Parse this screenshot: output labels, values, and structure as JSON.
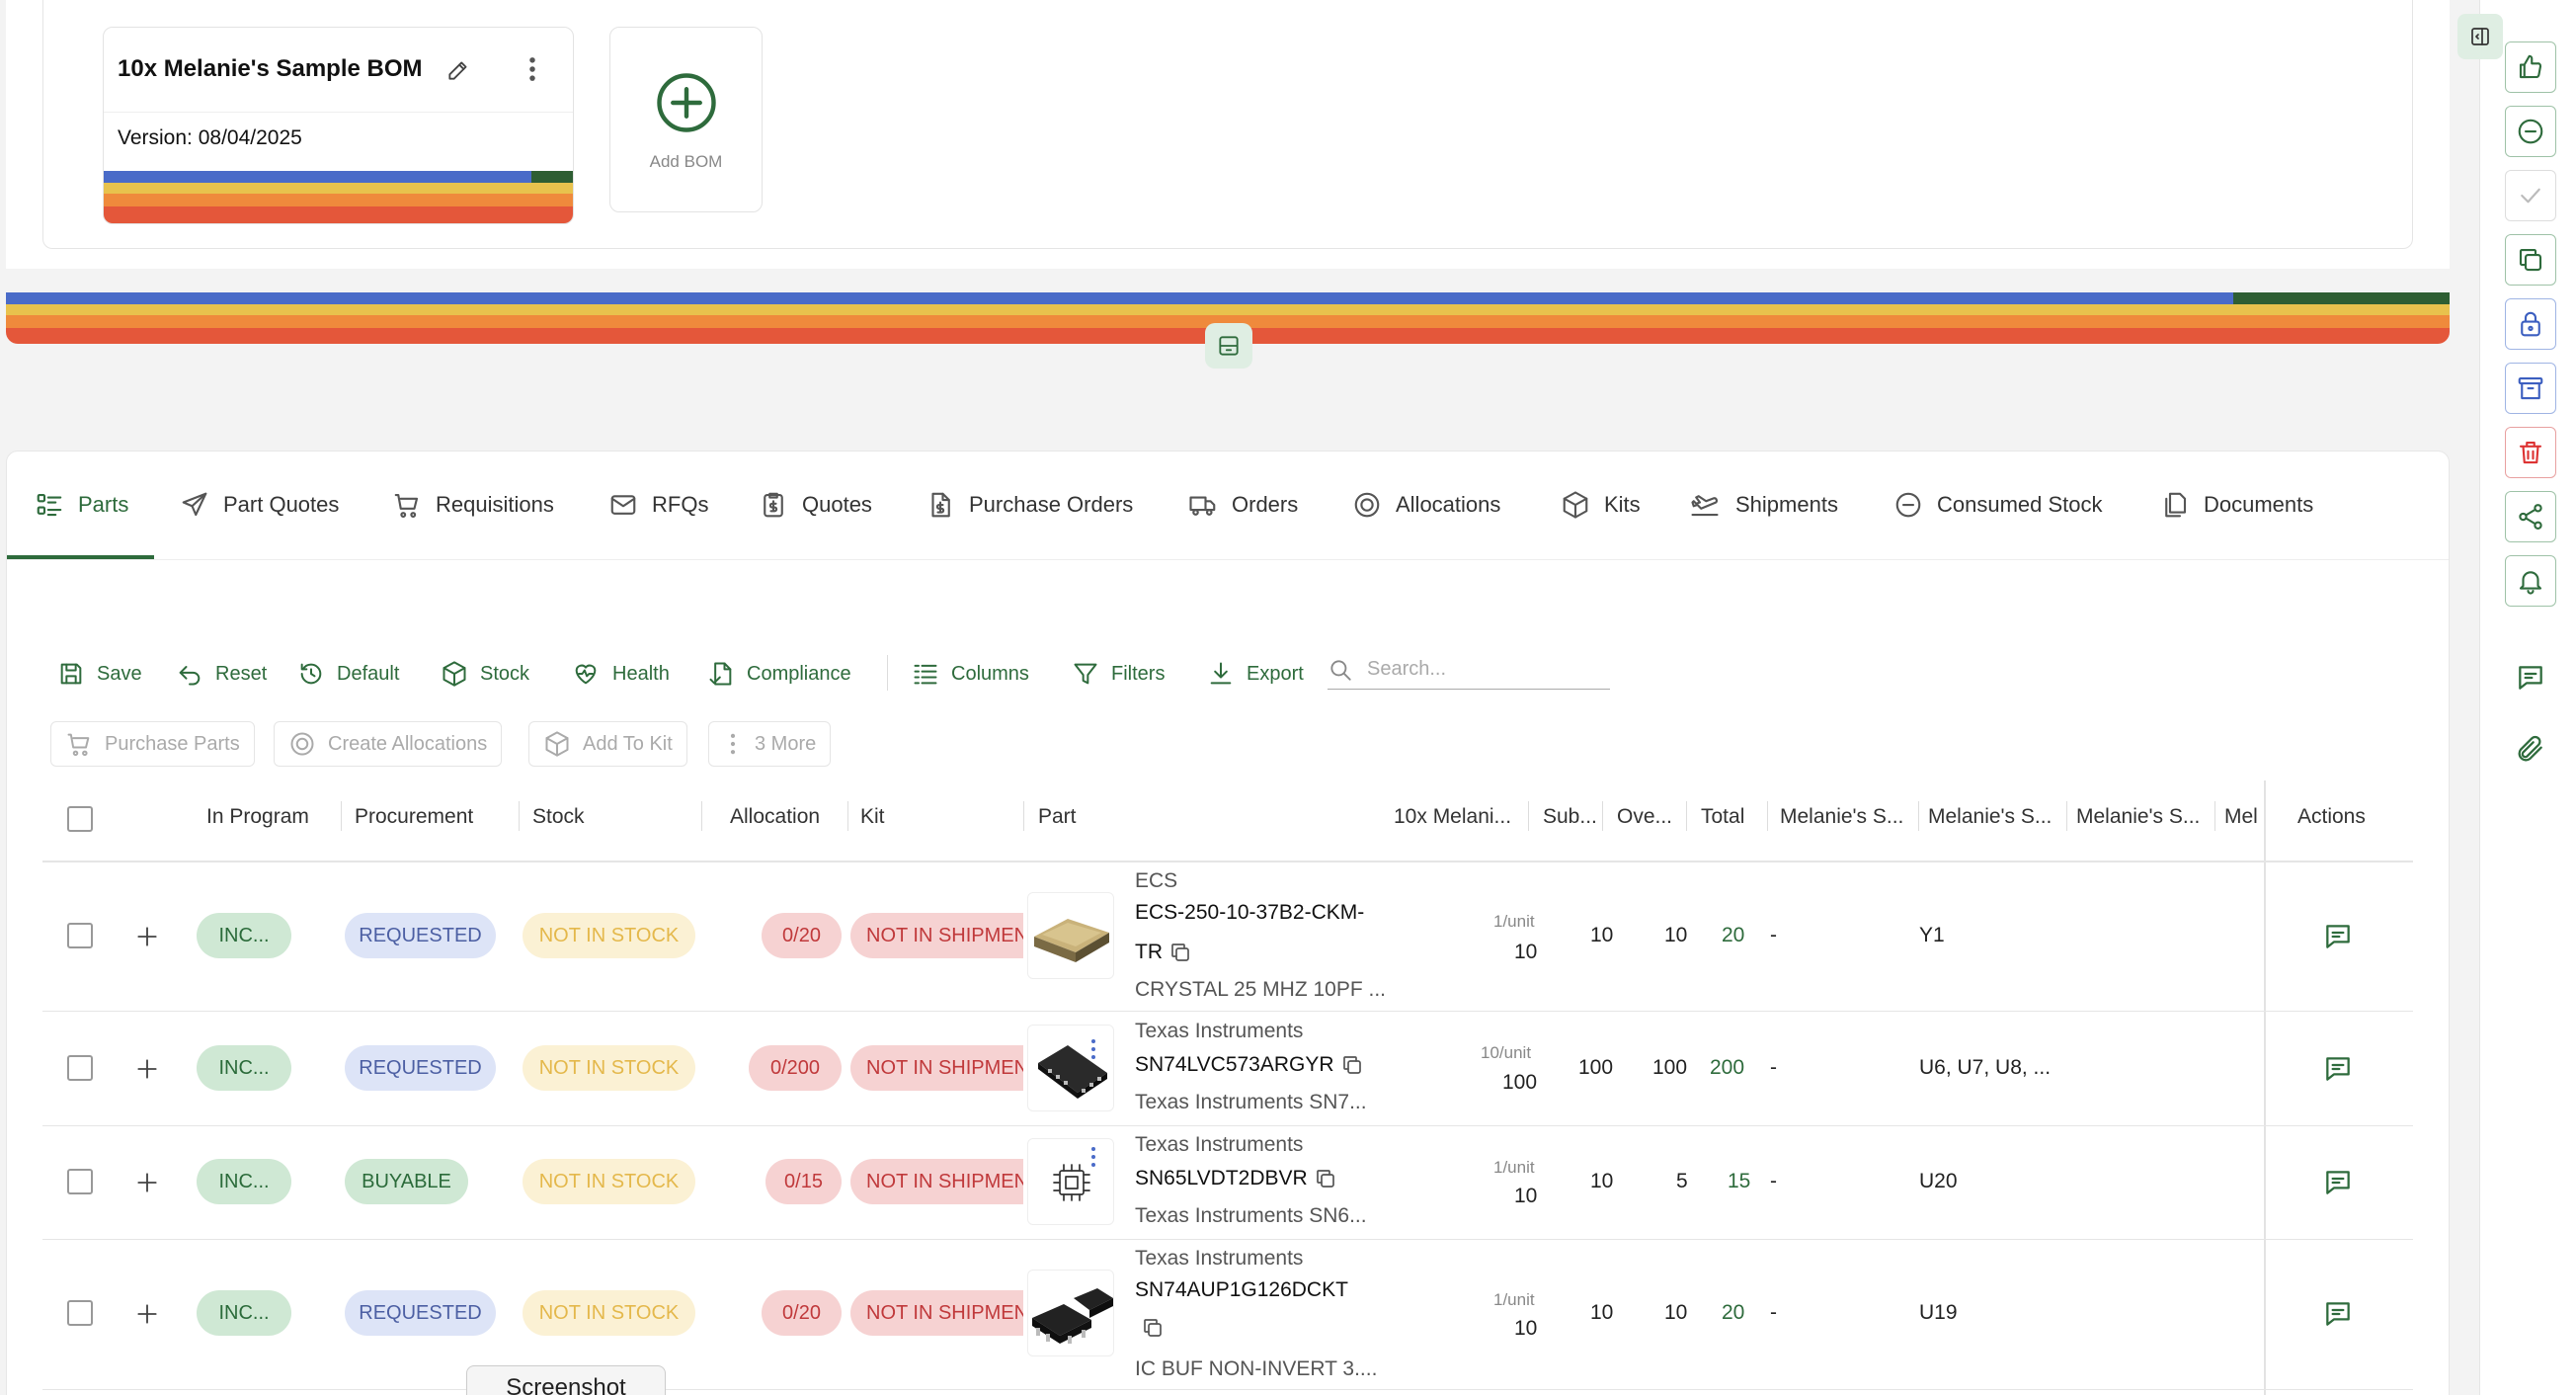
{
  "bom": {
    "title": "10x Melanie's Sample BOM",
    "version": "Version: 08/04/2025",
    "add_label": "Add BOM"
  },
  "status_colors": {
    "blue": "#4a6bc8",
    "yellow": "#e8c24d",
    "orange": "#ef8a3c",
    "red": "#e4573a",
    "green": "#2e6b3c"
  },
  "tabs": [
    {
      "label": "Parts",
      "icon": "list-icon",
      "active": true
    },
    {
      "label": "Part Quotes",
      "icon": "send-icon"
    },
    {
      "label": "Requisitions",
      "icon": "cart-icon"
    },
    {
      "label": "RFQs",
      "icon": "mail-icon"
    },
    {
      "label": "Quotes",
      "icon": "dollar-clipboard-icon"
    },
    {
      "label": "Purchase Orders",
      "icon": "dollar-file-icon"
    },
    {
      "label": "Orders",
      "icon": "truck-icon"
    },
    {
      "label": "Allocations",
      "icon": "target-icon"
    },
    {
      "label": "Kits",
      "icon": "box-icon"
    },
    {
      "label": "Shipments",
      "icon": "plane-icon"
    },
    {
      "label": "Consumed Stock",
      "icon": "minus-circle-icon"
    },
    {
      "label": "Documents",
      "icon": "documents-icon"
    }
  ],
  "toolbar": {
    "save": "Save",
    "reset": "Reset",
    "default": "Default",
    "stock": "Stock",
    "health": "Health",
    "compliance": "Compliance",
    "columns": "Columns",
    "filters": "Filters",
    "export": "Export",
    "search_placeholder": "Search...",
    "purchase_parts": "Purchase Parts",
    "create_allocations": "Create Allocations",
    "add_to_kit": "Add To Kit",
    "more": "3 More"
  },
  "columns": {
    "in_program": "In Program",
    "procurement": "Procurement",
    "stock": "Stock",
    "allocation": "Allocation",
    "kit": "Kit",
    "part": "Part",
    "bom_qty": "10x Melani...",
    "sub": "Sub...",
    "over": "Ove...",
    "total": "Total",
    "mel1": "Melanie's S...",
    "mel2": "Melanie's S...",
    "mel3": "Melanie's S...",
    "mel4": "Mel",
    "actions": "Actions"
  },
  "rows": [
    {
      "in_program": "INC...",
      "procurement": "REQUESTED",
      "stock": "NOT IN STOCK",
      "allocation": "0/20",
      "kit": "NOT IN SHIPMENT",
      "mfr": "ECS",
      "mpn1": "ECS-250-10-37B2-CKM-",
      "mpn2": "TR",
      "desc": "CRYSTAL 25 MHZ 10PF ...",
      "per_unit": "1/unit",
      "qty": "10",
      "sub": "10",
      "over": "10",
      "total": "20",
      "mel1": "-",
      "mel2": "Y1"
    },
    {
      "in_program": "INC...",
      "procurement": "REQUESTED",
      "stock": "NOT IN STOCK",
      "allocation": "0/200",
      "kit": "NOT IN SHIPMENT",
      "mfr": "Texas Instruments",
      "mpn1": "SN74LVC573ARGYR",
      "mpn2": "",
      "desc": "Texas Instruments SN7...",
      "per_unit": "10/unit",
      "qty": "100",
      "sub": "100",
      "over": "100",
      "total": "200",
      "mel1": "-",
      "mel2": "U6, U7, U8, ..."
    },
    {
      "in_program": "INC...",
      "procurement": "BUYABLE",
      "stock": "NOT IN STOCK",
      "allocation": "0/15",
      "kit": "NOT IN SHIPMENT",
      "mfr": "Texas Instruments",
      "mpn1": "SN65LVDT2DBVR",
      "mpn2": "",
      "desc": "Texas Instruments SN6...",
      "per_unit": "1/unit",
      "qty": "10",
      "sub": "10",
      "over": "5",
      "total": "15",
      "mel1": "-",
      "mel2": "U20"
    },
    {
      "in_program": "INC...",
      "procurement": "REQUESTED",
      "stock": "NOT IN STOCK",
      "allocation": "0/20",
      "kit": "NOT IN SHIPMENT",
      "mfr": "Texas Instruments",
      "mpn1": "SN74AUP1G126DCKT",
      "mpn2": "",
      "desc": "IC BUF NON-INVERT 3....",
      "per_unit": "1/unit",
      "qty": "10",
      "sub": "10",
      "over": "10",
      "total": "20",
      "mel1": "-",
      "mel2": "U19"
    }
  ],
  "tooltip": "Screenshot"
}
